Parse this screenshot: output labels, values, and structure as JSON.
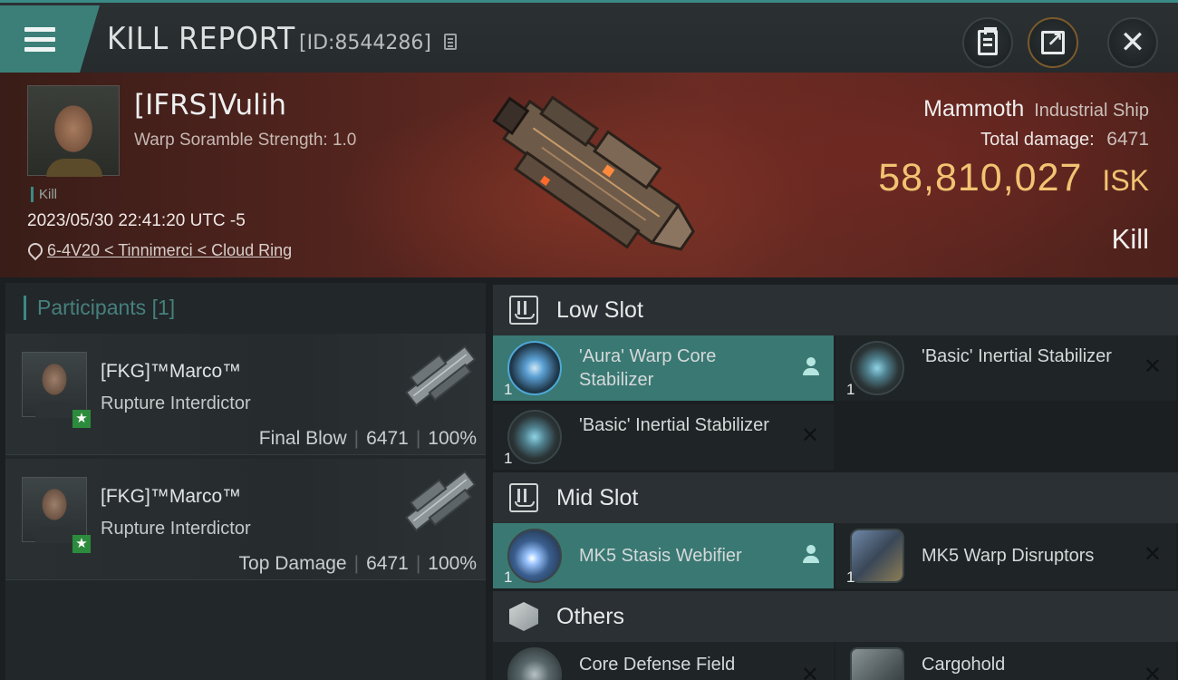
{
  "header": {
    "title": "KILL REPORT",
    "report_id": "[ID:8544286]"
  },
  "victim": {
    "name": "[IFRS]Vulih",
    "scramble": "Warp Soramble Strength: 1.0",
    "tag": "Kill",
    "datetime": "2023/05/30 22:41:20 UTC -5",
    "location": "6-4V20 < Tinnimerci < Cloud Ring",
    "ship_name": "Mammoth",
    "ship_class": "Industrial Ship",
    "damage_label": "Total damage:",
    "damage_value": "6471",
    "isk_value": "58,810,027",
    "isk_unit": "ISK",
    "result": "Kill"
  },
  "participants": {
    "header": "Participants",
    "count": "[1]",
    "items": [
      {
        "name": "[FKG]™Marco™",
        "ship": "Rupture Interdictor",
        "label": "Final Blow",
        "damage": "6471",
        "percent": "100%",
        "badge": "★"
      },
      {
        "name": "[FKG]™Marco™",
        "ship": "Rupture Interdictor",
        "label": "Top Damage",
        "damage": "6471",
        "percent": "100%",
        "badge": "★"
      }
    ]
  },
  "slots": {
    "low": {
      "title": "Low Slot",
      "items": [
        {
          "qty": "1",
          "name": "'Aura' Warp Core Stabilizer"
        },
        {
          "qty": "1",
          "name": "'Basic' Inertial Stabilizer"
        },
        {
          "qty": "1",
          "name": "'Basic' Inertial Stabilizer"
        }
      ]
    },
    "mid": {
      "title": "Mid Slot",
      "items": [
        {
          "qty": "1",
          "name": "MK5 Stasis Webifier"
        },
        {
          "qty": "1",
          "name": "MK5 Warp Disruptors"
        }
      ]
    },
    "others": {
      "title": "Others",
      "items": [
        {
          "qty": "1",
          "name": "Core Defense Field"
        },
        {
          "qty": "1",
          "name": "Cargohold"
        }
      ]
    }
  },
  "icons": {
    "menu": "menu-icon",
    "copy": "copy-icon",
    "clipboard": "clipboard-icon",
    "share": "share-icon",
    "close": "close-icon",
    "pin": "location-pin-icon",
    "person": "person-icon",
    "x": "x-icon"
  },
  "colors": {
    "accent": "#3a8a86",
    "isk": "#f1c372",
    "active_item": "#3a7873",
    "badge": "#2c8b3c"
  }
}
